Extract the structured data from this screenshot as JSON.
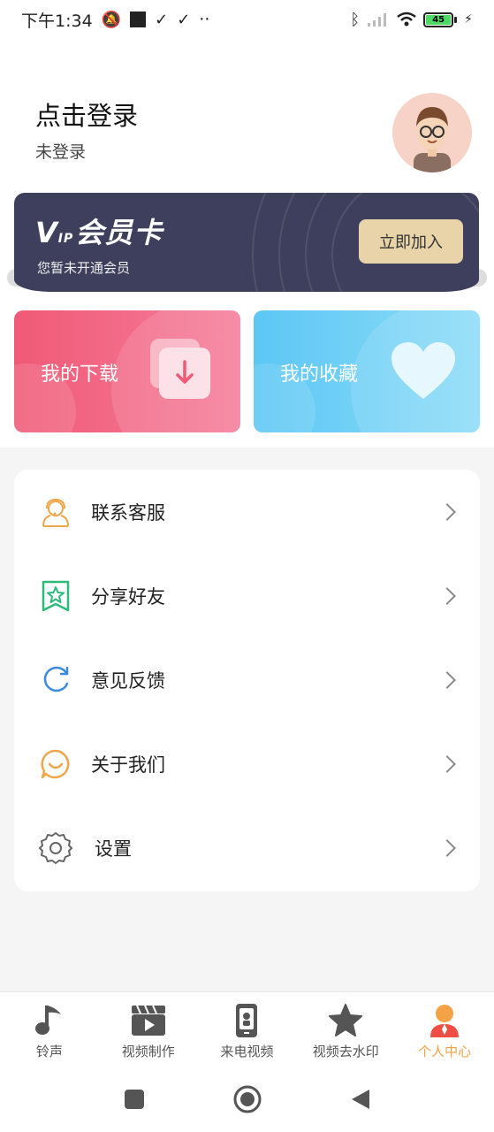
{
  "status_bar": {
    "time": "下午1:34",
    "battery": "45"
  },
  "profile": {
    "title": "点击登录",
    "subtitle": "未登录"
  },
  "vip": {
    "brand_v": "V",
    "brand_ip": "IP",
    "brand_name": "会员卡",
    "status": "您暂未开通会员",
    "join_label": "立即加入"
  },
  "cards": {
    "download": "我的下载",
    "favorite": "我的收藏"
  },
  "menu": [
    {
      "label": "联系客服",
      "icon": "headset-icon"
    },
    {
      "label": "分享好友",
      "icon": "share-star-icon"
    },
    {
      "label": "意见反馈",
      "icon": "refresh-icon"
    },
    {
      "label": "关于我们",
      "icon": "smile-bubble-icon"
    },
    {
      "label": "设置",
      "icon": "gear-icon"
    }
  ],
  "nav": [
    {
      "label": "铃声",
      "icon": "music-note-icon"
    },
    {
      "label": "视频制作",
      "icon": "clapperboard-icon"
    },
    {
      "label": "来电视频",
      "icon": "phone-video-icon"
    },
    {
      "label": "视频去水印",
      "icon": "star-icon"
    },
    {
      "label": "个人中心",
      "icon": "person-icon"
    }
  ],
  "colors": {
    "active_nav": "#f5a146",
    "vip_card": "#3d3f5c",
    "vip_button": "#e8d4a8"
  }
}
